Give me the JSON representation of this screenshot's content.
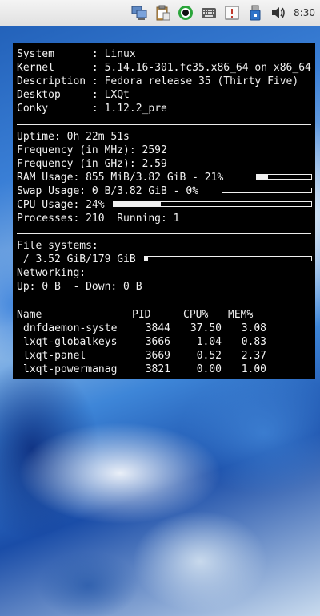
{
  "panel": {
    "clock": "8:30",
    "tray_icons": [
      "network-icon",
      "clipboard-icon",
      "record-indicator-icon",
      "keyboard-icon",
      "notification-icon",
      "usb-device-icon",
      "volume-icon"
    ]
  },
  "conky": {
    "info": [
      {
        "label": "System     ",
        "value": ": Linux"
      },
      {
        "label": "Kernel     ",
        "value": ": 5.14.16-301.fc35.x86_64 on x86_64"
      },
      {
        "label": "Description",
        "value": ": Fedora release 35 (Thirty Five)"
      },
      {
        "label": "Desktop    ",
        "value": ": LXQt"
      },
      {
        "label": "Conky      ",
        "value": ": 1.12.2_pre"
      }
    ],
    "stats": {
      "uptime": "Uptime: 0h 22m 51s",
      "freq_mhz": "Frequency (in MHz): 2592",
      "freq_ghz": "Frequency (in GHz): 2.59",
      "ram": {
        "text": "RAM Usage: 855 MiB/3.82 GiB - 21%",
        "percent": 21
      },
      "swap": {
        "text": "Swap Usage: 0 B/3.82 GiB - 0%",
        "percent": 0
      },
      "cpu": {
        "text": "CPU Usage: 24%",
        "percent": 24
      },
      "processes": "Processes: 210  Running: 1"
    },
    "filesystems": {
      "heading": "File systems:",
      "root": {
        "text": " / 3.52 GiB/179 GiB",
        "percent": 2
      },
      "net_heading": "Networking:",
      "net": "Up: 0 B  - Down: 0 B"
    },
    "processes": {
      "headers": {
        "name": "Name",
        "pid": "PID",
        "cpu": "CPU%",
        "mem": "MEM%"
      },
      "rows": [
        {
          "name": "dnfdaemon-syste",
          "pid": "3844",
          "cpu": "37.50",
          "mem": "3.08"
        },
        {
          "name": "lxqt-globalkeys",
          "pid": "3666",
          "cpu": "1.04",
          "mem": "0.83"
        },
        {
          "name": "lxqt-panel",
          "pid": "3669",
          "cpu": "0.52",
          "mem": "2.37"
        },
        {
          "name": "lxqt-powermanag",
          "pid": "3821",
          "cpu": "0.00",
          "mem": "1.00"
        }
      ]
    }
  }
}
